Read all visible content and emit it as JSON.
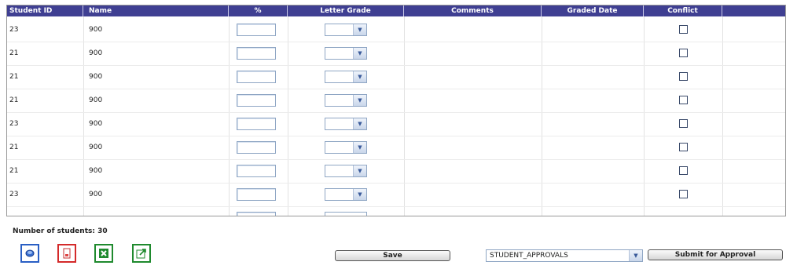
{
  "table": {
    "headers": {
      "student_id": "Student ID",
      "name": "Name",
      "percent": "%",
      "letter_grade": "Letter Grade",
      "comments": "Comments",
      "graded_date": "Graded Date",
      "conflict": "Conflict"
    },
    "rows": [
      {
        "student_id": "23",
        "name": "900"
      },
      {
        "student_id": "21",
        "name": "900"
      },
      {
        "student_id": "21",
        "name": "900"
      },
      {
        "student_id": "21",
        "name": "900"
      },
      {
        "student_id": "23",
        "name": "900"
      },
      {
        "student_id": "21",
        "name": "900"
      },
      {
        "student_id": "21",
        "name": "900"
      },
      {
        "student_id": "23",
        "name": "900"
      }
    ]
  },
  "footer": {
    "student_count": "Number of students: 30",
    "save_label": "Save",
    "approval_value": "STUDENT_APPROVALS",
    "submit_label": "Submit for Approval"
  },
  "icons": [
    "refresh-icon",
    "pdf-icon",
    "excel-icon",
    "export-icon"
  ],
  "colors": {
    "header_bg": "#3f3f92",
    "header_text": "#ffffff",
    "input_border": "#8fa6c4"
  }
}
